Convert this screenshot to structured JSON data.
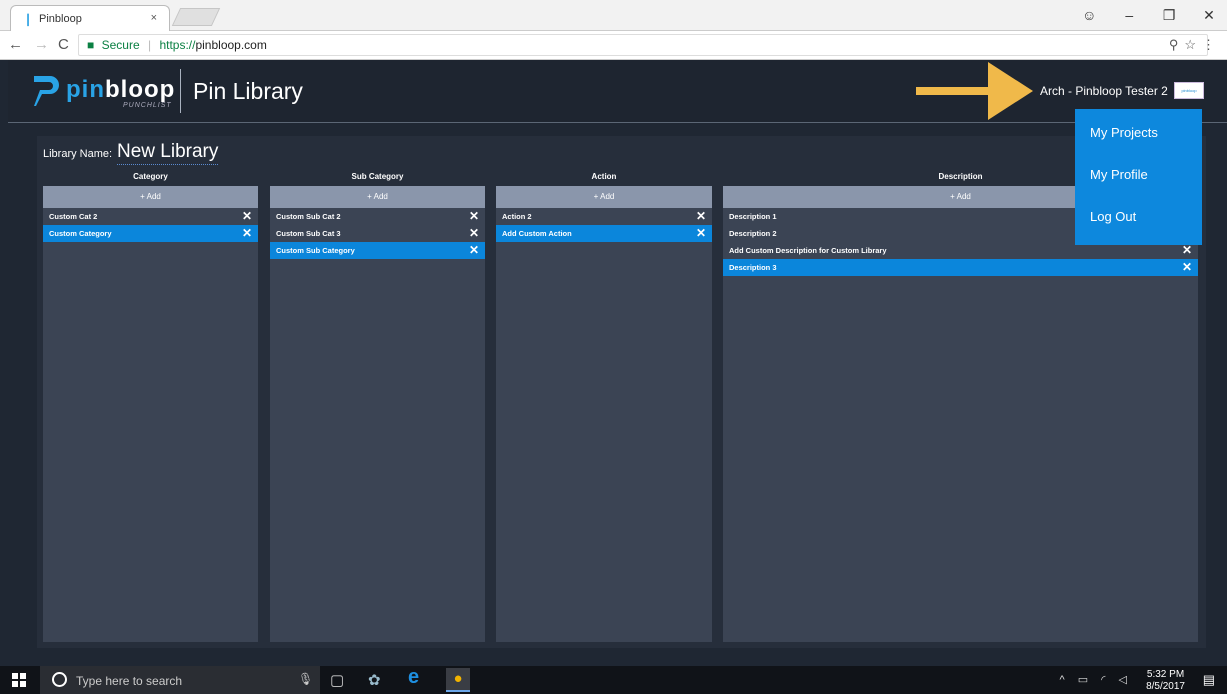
{
  "browser": {
    "tab_title": "Pinbloop",
    "tab_close": "×",
    "url_secure_label": "Secure",
    "url_protocol": "https://",
    "url_host": "pinbloop.com",
    "controls": {
      "back": "←",
      "forward": "→",
      "reload": "C",
      "zoom": "⚲",
      "bookmark": "☆",
      "menu": "⋮"
    },
    "window": {
      "account": "☺",
      "minimize": "–",
      "maximize": "❐",
      "close": "✕"
    }
  },
  "header": {
    "logo_left": "pin",
    "logo_right": "bloop",
    "logo_sub": "PUNCHLIST",
    "page_title": "Pin Library",
    "user_name": "Arch - Pinbloop Tester 2",
    "avatar_text": "pinbloop"
  },
  "user_menu": {
    "items": [
      "My Projects",
      "My Profile",
      "Log Out"
    ]
  },
  "library": {
    "label": "Library Name:",
    "name": "New Library"
  },
  "columns": {
    "category": {
      "title": "Category",
      "add_label": "+ Add",
      "rows": [
        "Custom Cat 2",
        "Custom Category"
      ]
    },
    "sub_category": {
      "title": "Sub Category",
      "add_label": "+ Add",
      "rows": [
        "Custom Sub Cat 2",
        "Custom Sub Cat 3",
        "Custom Sub Category"
      ]
    },
    "action": {
      "title": "Action",
      "add_label": "+ Add",
      "rows": [
        "Action 2",
        "Add Custom Action"
      ]
    },
    "description": {
      "title": "Description",
      "add_label": "+ Add",
      "rows": [
        "Description 1",
        "Description 2",
        "Add Custom Description for Custom Library",
        "Description 3"
      ]
    },
    "delete_glyph": "✕"
  },
  "taskbar": {
    "search_placeholder": "Type here to search",
    "time": "5:32 PM",
    "date": "8/5/2017"
  },
  "colors": {
    "accent": "#0b86db",
    "arrow": "#f0b94a",
    "panel": "#3b4454",
    "add_bar": "#8a96ab"
  }
}
